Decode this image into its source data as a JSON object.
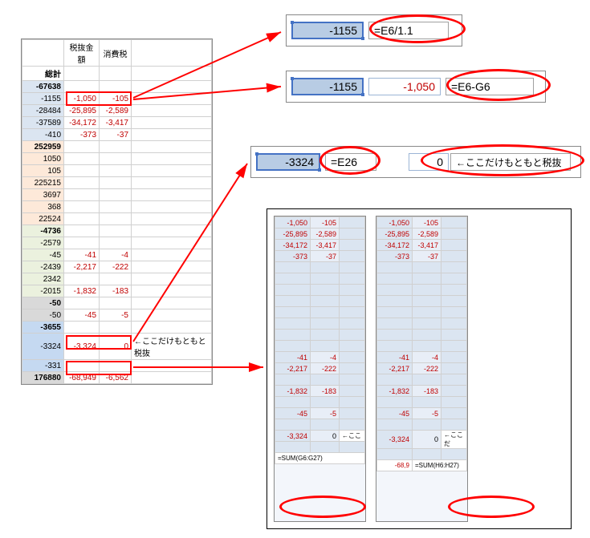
{
  "headers": {
    "col_b": "税抜金額",
    "col_c": "消費税"
  },
  "total_label": "総計",
  "rows": [
    {
      "a": "-67638",
      "bold": true,
      "cls": "hl-blue"
    },
    {
      "a": "-1155",
      "b": "-1,050",
      "c": "-105",
      "cls": "hl-blue",
      "neg": true
    },
    {
      "a": "-28484",
      "b": "-25,895",
      "c": "-2,589",
      "cls": "hl-blue",
      "neg": true
    },
    {
      "a": "-37589",
      "b": "-34,172",
      "c": "-3,417",
      "cls": "hl-blue",
      "neg": true
    },
    {
      "a": "-410",
      "b": "-373",
      "c": "-37",
      "cls": "hl-blue",
      "neg": true
    },
    {
      "a": "252959",
      "bold": true,
      "cls": "hl-tan"
    },
    {
      "a": "1050",
      "cls": "hl-tan"
    },
    {
      "a": "105",
      "cls": "hl-tan"
    },
    {
      "a": "225215",
      "cls": "hl-tan"
    },
    {
      "a": "3697",
      "cls": "hl-tan"
    },
    {
      "a": "368",
      "cls": "hl-tan"
    },
    {
      "a": "22524",
      "cls": "hl-tan"
    },
    {
      "a": "-4736",
      "bold": true,
      "cls": "hl-olive"
    },
    {
      "a": "-2579",
      "cls": "hl-olive"
    },
    {
      "a": "-45",
      "b": "-41",
      "c": "-4",
      "cls": "hl-olive",
      "neg": true
    },
    {
      "a": "-2439",
      "b": "-2,217",
      "c": "-222",
      "cls": "hl-olive",
      "neg": true
    },
    {
      "a": "2342",
      "cls": "hl-olive"
    },
    {
      "a": "-2015",
      "b": "-1,832",
      "c": "-183",
      "cls": "hl-olive",
      "neg": true
    },
    {
      "a": "-50",
      "bold": true,
      "cls": "hl-gray"
    },
    {
      "a": "-50",
      "b": "-45",
      "c": "-5",
      "cls": "hl-gray",
      "neg": true
    },
    {
      "a": "-3655",
      "bold": true,
      "cls": "hl-blue2"
    },
    {
      "a": "-3324",
      "b": "-3,324",
      "c": "0",
      "cls": "hl-blue2",
      "neg": true,
      "note": "←ここだけもともと税抜"
    },
    {
      "a": "-331",
      "cls": "hl-blue2"
    },
    {
      "a": "176880",
      "b": "-68,949",
      "c": "-6,562",
      "cls": "hl-gray",
      "bold": true,
      "neg": true
    }
  ],
  "callout1": {
    "val": "-1155",
    "formula": "=E6/1.1"
  },
  "callout2": {
    "val": "-1155",
    "mid": "-1,050",
    "formula": "=E6-G6"
  },
  "callout3": {
    "val": "-3324",
    "mid": "=E26",
    "right": "0",
    "note": "←ここだけもともと税抜"
  },
  "mini_left": {
    "rows": [
      [
        "-1,050",
        "-105"
      ],
      [
        "-25,895",
        "-2,589"
      ],
      [
        "-34,172",
        "-3,417"
      ],
      [
        "-373",
        "-37"
      ],
      [
        "",
        ""
      ],
      [
        "",
        ""
      ],
      [
        "",
        ""
      ],
      [
        "",
        ""
      ],
      [
        "",
        ""
      ],
      [
        "",
        ""
      ],
      [
        "",
        ""
      ],
      [
        "",
        ""
      ],
      [
        "-41",
        "-4"
      ],
      [
        "-2,217",
        "-222"
      ],
      [
        "",
        ""
      ],
      [
        "-1,832",
        "-183"
      ],
      [
        "",
        ""
      ],
      [
        "-45",
        "-5"
      ],
      [
        "",
        ""
      ],
      [
        "-3,324",
        "0",
        "←ここ"
      ],
      [
        "",
        ""
      ]
    ],
    "sum": "=SUM(G6:G27)"
  },
  "mini_right": {
    "rows": [
      [
        "-1,050",
        "-105"
      ],
      [
        "-25,895",
        "-2,589"
      ],
      [
        "-34,172",
        "-3,417"
      ],
      [
        "-373",
        "-37"
      ],
      [
        "",
        ""
      ],
      [
        "",
        ""
      ],
      [
        "",
        ""
      ],
      [
        "",
        ""
      ],
      [
        "",
        ""
      ],
      [
        "",
        ""
      ],
      [
        "",
        ""
      ],
      [
        "",
        ""
      ],
      [
        "-41",
        "-4"
      ],
      [
        "-2,217",
        "-222"
      ],
      [
        "",
        ""
      ],
      [
        "-1,832",
        "-183"
      ],
      [
        "",
        ""
      ],
      [
        "-45",
        "-5"
      ],
      [
        "",
        ""
      ],
      [
        "-3,324",
        "0",
        "←ここだ"
      ],
      [
        "",
        ""
      ]
    ],
    "sum_prefix": "-68,9",
    "sum": "=SUM(H6:H27)"
  }
}
